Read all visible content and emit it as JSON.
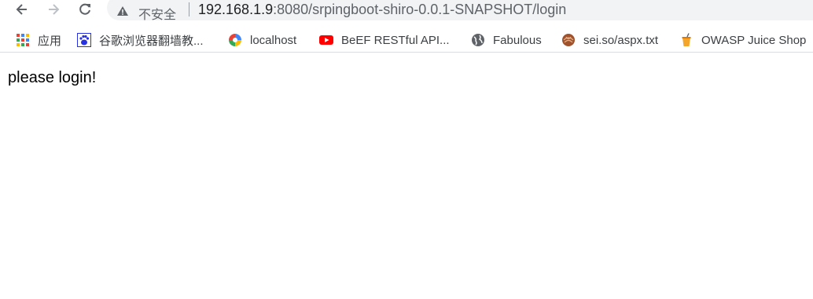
{
  "browser": {
    "security_text": "不安全",
    "url_host": "192.168.1.9",
    "url_rest": ":8080/srpingboot-shiro-0.0.1-SNAPSHOT/login"
  },
  "bookmarks": [
    {
      "label": "应用",
      "icon": "apps-grid-icon"
    },
    {
      "label": "谷歌浏览器翻墙教...",
      "icon": "baidu-paw-icon"
    },
    {
      "label": "localhost",
      "icon": "colorful-swirl-icon"
    },
    {
      "label": "BeEF RESTful API...",
      "icon": "youtube-icon"
    },
    {
      "label": "Fabulous",
      "icon": "globe-icon"
    },
    {
      "label": "sei.so/aspx.txt",
      "icon": "swirl-ball-icon"
    },
    {
      "label": "OWASP Juice Shop",
      "icon": "juice-cup-icon"
    }
  ],
  "page": {
    "message": "please login!"
  },
  "colors": {
    "omnibox_bg": "#f1f3f4",
    "youtube_red": "#ff0000",
    "text": "#202124"
  }
}
